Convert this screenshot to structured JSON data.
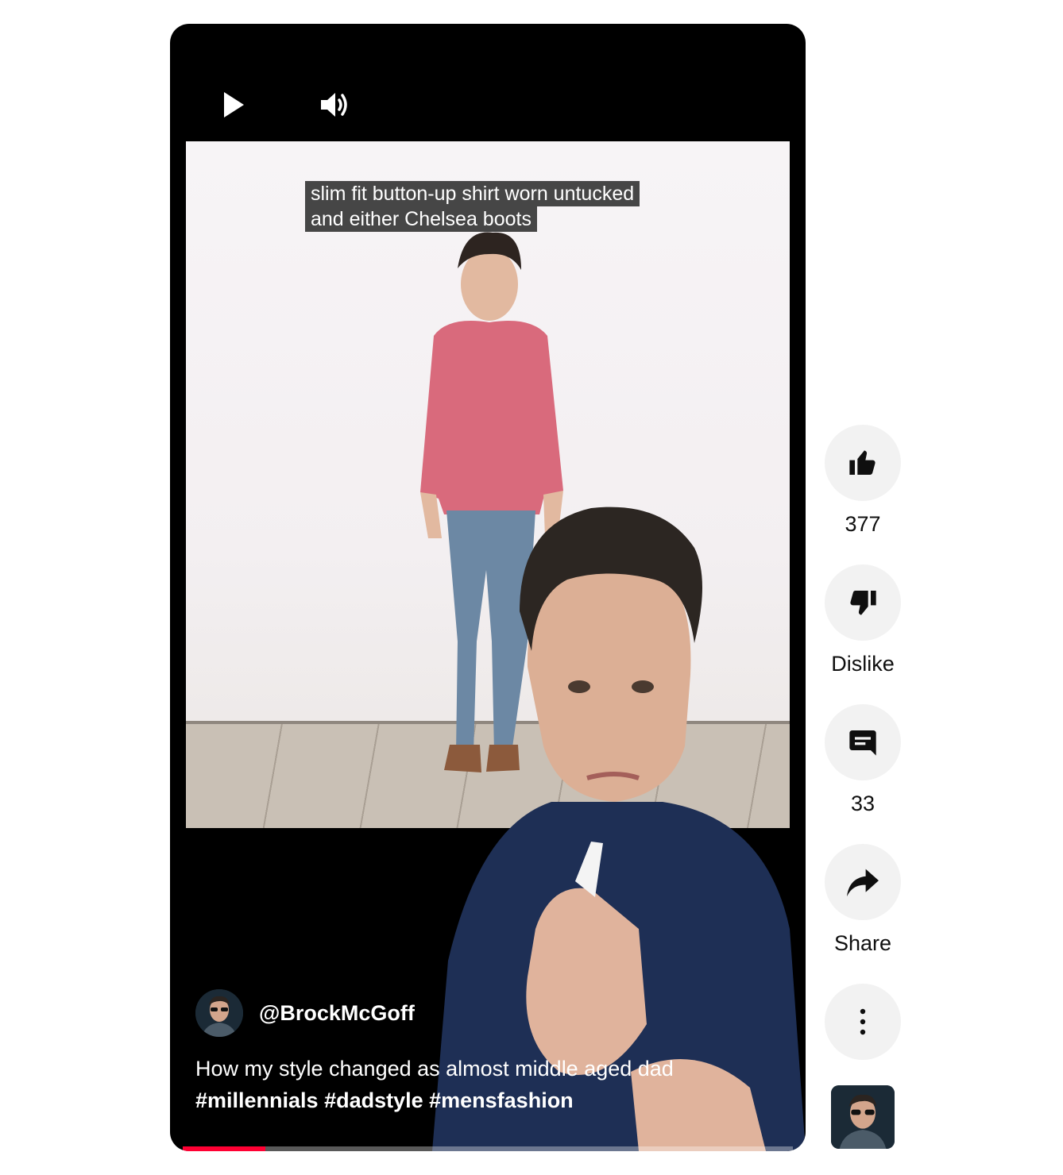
{
  "player": {
    "caption_lines": [
      "slim fit button-up shirt worn untucked",
      "and either Chelsea boots"
    ],
    "channel_handle": "@BrockMcGoff",
    "title": "How my style changed as almost middle aged dad",
    "hashtags": "#millennials #dadstyle #mensfashion",
    "progress_fraction": 0.135,
    "progress_color": "#ff0033",
    "controls": {
      "play_icon": "play-icon",
      "volume_icon": "volume-icon"
    }
  },
  "actions": {
    "like": {
      "label": "377",
      "icon": "thumbs-up-icon"
    },
    "dislike": {
      "label": "Dislike",
      "icon": "thumbs-down-icon"
    },
    "comments": {
      "label": "33",
      "icon": "comment-icon"
    },
    "share": {
      "label": "Share",
      "icon": "share-icon"
    },
    "more": {
      "icon": "more-vertical-icon"
    }
  }
}
